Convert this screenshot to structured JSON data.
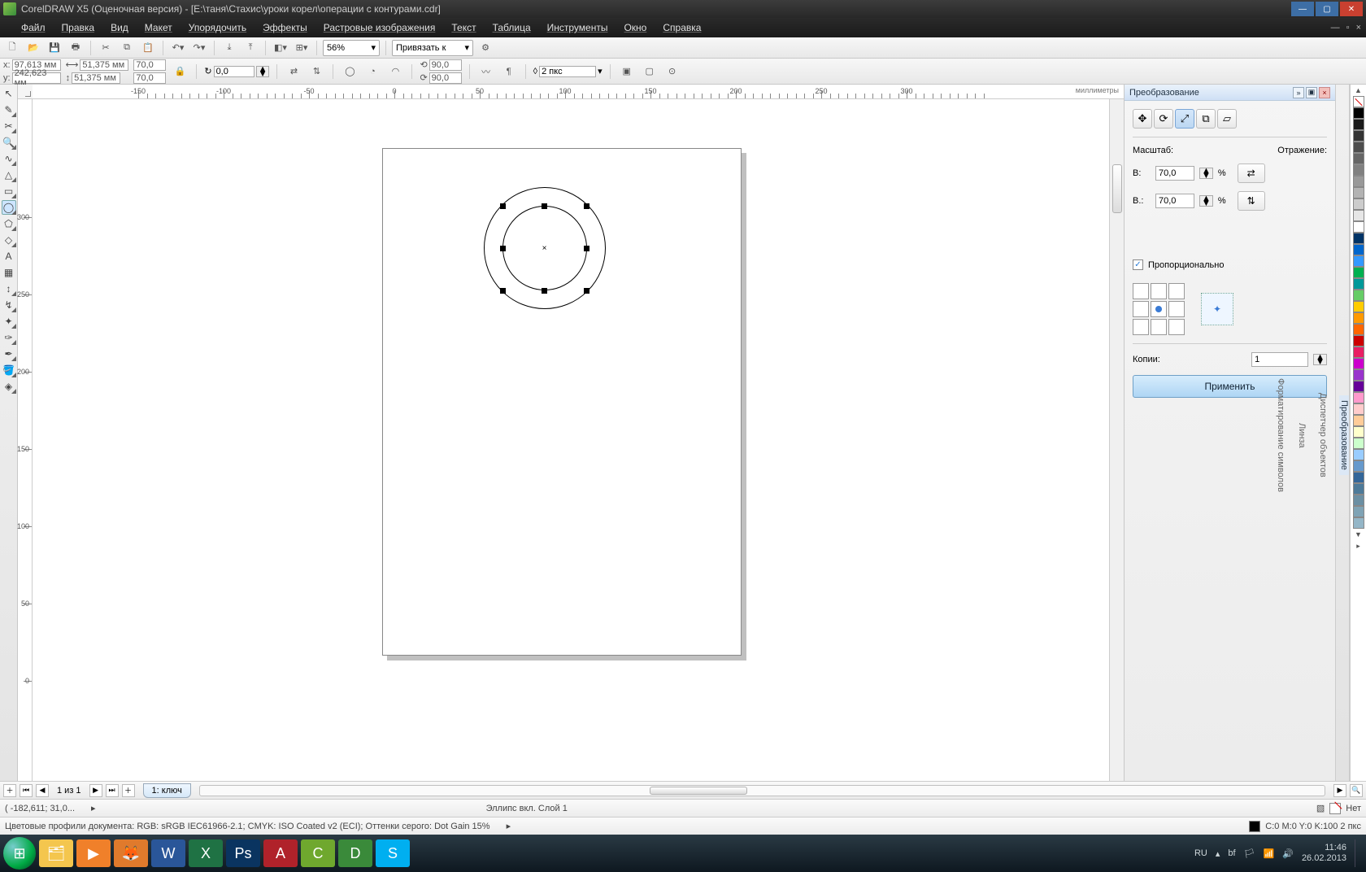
{
  "window": {
    "title": "CorelDRAW X5 (Оценочная версия) - [E:\\таня\\Стахис\\уроки корел\\операции с контурами.cdr]"
  },
  "menu": [
    "Файл",
    "Правка",
    "Вид",
    "Макет",
    "Упорядочить",
    "Эффекты",
    "Растровые изображения",
    "Текст",
    "Таблица",
    "Инструменты",
    "Окно",
    "Справка"
  ],
  "toolbar": {
    "zoom": "56%",
    "snap_label": "Привязать к"
  },
  "props": {
    "x_label": "x:",
    "x": "97,613 мм",
    "y_label": "y:",
    "y": "242,623 мм",
    "w": "51,375 мм",
    "h": "51,375 мм",
    "sx": "70,0",
    "sy": "70,0",
    "rot": "0,0",
    "ang1": "90,0",
    "ang2": "90,0",
    "outline_w": "2 пкс"
  },
  "transform": {
    "title": "Преобразование",
    "scale_label": "Масштаб:",
    "mirror_label": "Отражение:",
    "w_label": "В:",
    "h_label": "В.:",
    "w": "70,0",
    "h": "70,0",
    "percent": "%",
    "proportional": "Пропорционально",
    "copies_label": "Копии:",
    "copies": "1",
    "apply": "Применить"
  },
  "vertical_dockers": [
    "Преобразование",
    "Диспетчер объектов",
    "Линза",
    "Форматирование символов"
  ],
  "palette": [
    "#000000",
    "#1a1a1a",
    "#333333",
    "#4d4d4d",
    "#666666",
    "#808080",
    "#999999",
    "#b3b3b3",
    "#cccccc",
    "#e6e6e6",
    "#ffffff",
    "#003366",
    "#0066cc",
    "#3399ff",
    "#00b050",
    "#009999",
    "#66cc66",
    "#ffcc00",
    "#ff9900",
    "#ff6600",
    "#cc0000",
    "#e91e63",
    "#cc00cc",
    "#9933cc",
    "#660099",
    "#ff99cc",
    "#ffcccc",
    "#ffcc99",
    "#ffffcc",
    "#ccffcc",
    "#99ccff",
    "#6699cc",
    "#336699",
    "#4d7a99",
    "#6b8fa3",
    "#7fa3b5",
    "#94b6c7"
  ],
  "pagebar": {
    "counter": "1 из 1",
    "tab": "1: ключ"
  },
  "status1": {
    "coords": "( -182,611; 31,0...",
    "object": "Эллипс вкл. Слой 1",
    "fill": "Нет"
  },
  "status2": {
    "profiles": "Цветовые профили документа: RGB: sRGB IEC61966-2.1; CMYK: ISO Coated v2 (ECI); Оттенки серого: Dot Gain 15%",
    "cmyk": "C:0 M:0 Y:0 K:100  2 пкс"
  },
  "ruler_units": "миллиметры",
  "taskbar": {
    "lang": "RU",
    "time": "11:46",
    "date": "26.02.2013"
  },
  "hruler_labels": [
    {
      "pos": 130,
      "txt": "-150"
    },
    {
      "pos": 235,
      "txt": "-100"
    },
    {
      "pos": 340,
      "txt": "-50"
    },
    {
      "pos": 445,
      "txt": "0"
    },
    {
      "pos": 550,
      "txt": "50"
    },
    {
      "pos": 655,
      "txt": "100"
    },
    {
      "pos": 760,
      "txt": "150"
    },
    {
      "pos": 865,
      "txt": "200"
    },
    {
      "pos": 970,
      "txt": "250"
    },
    {
      "pos": 1075,
      "txt": "300"
    }
  ],
  "vruler_labels": [
    {
      "pos": 715,
      "txt": "0"
    },
    {
      "pos": 620,
      "txt": "50"
    },
    {
      "pos": 525,
      "txt": "100"
    },
    {
      "pos": 430,
      "txt": "150"
    },
    {
      "pos": 335,
      "txt": "200"
    },
    {
      "pos": 240,
      "txt": "250"
    },
    {
      "pos": 145,
      "txt": "300"
    }
  ]
}
